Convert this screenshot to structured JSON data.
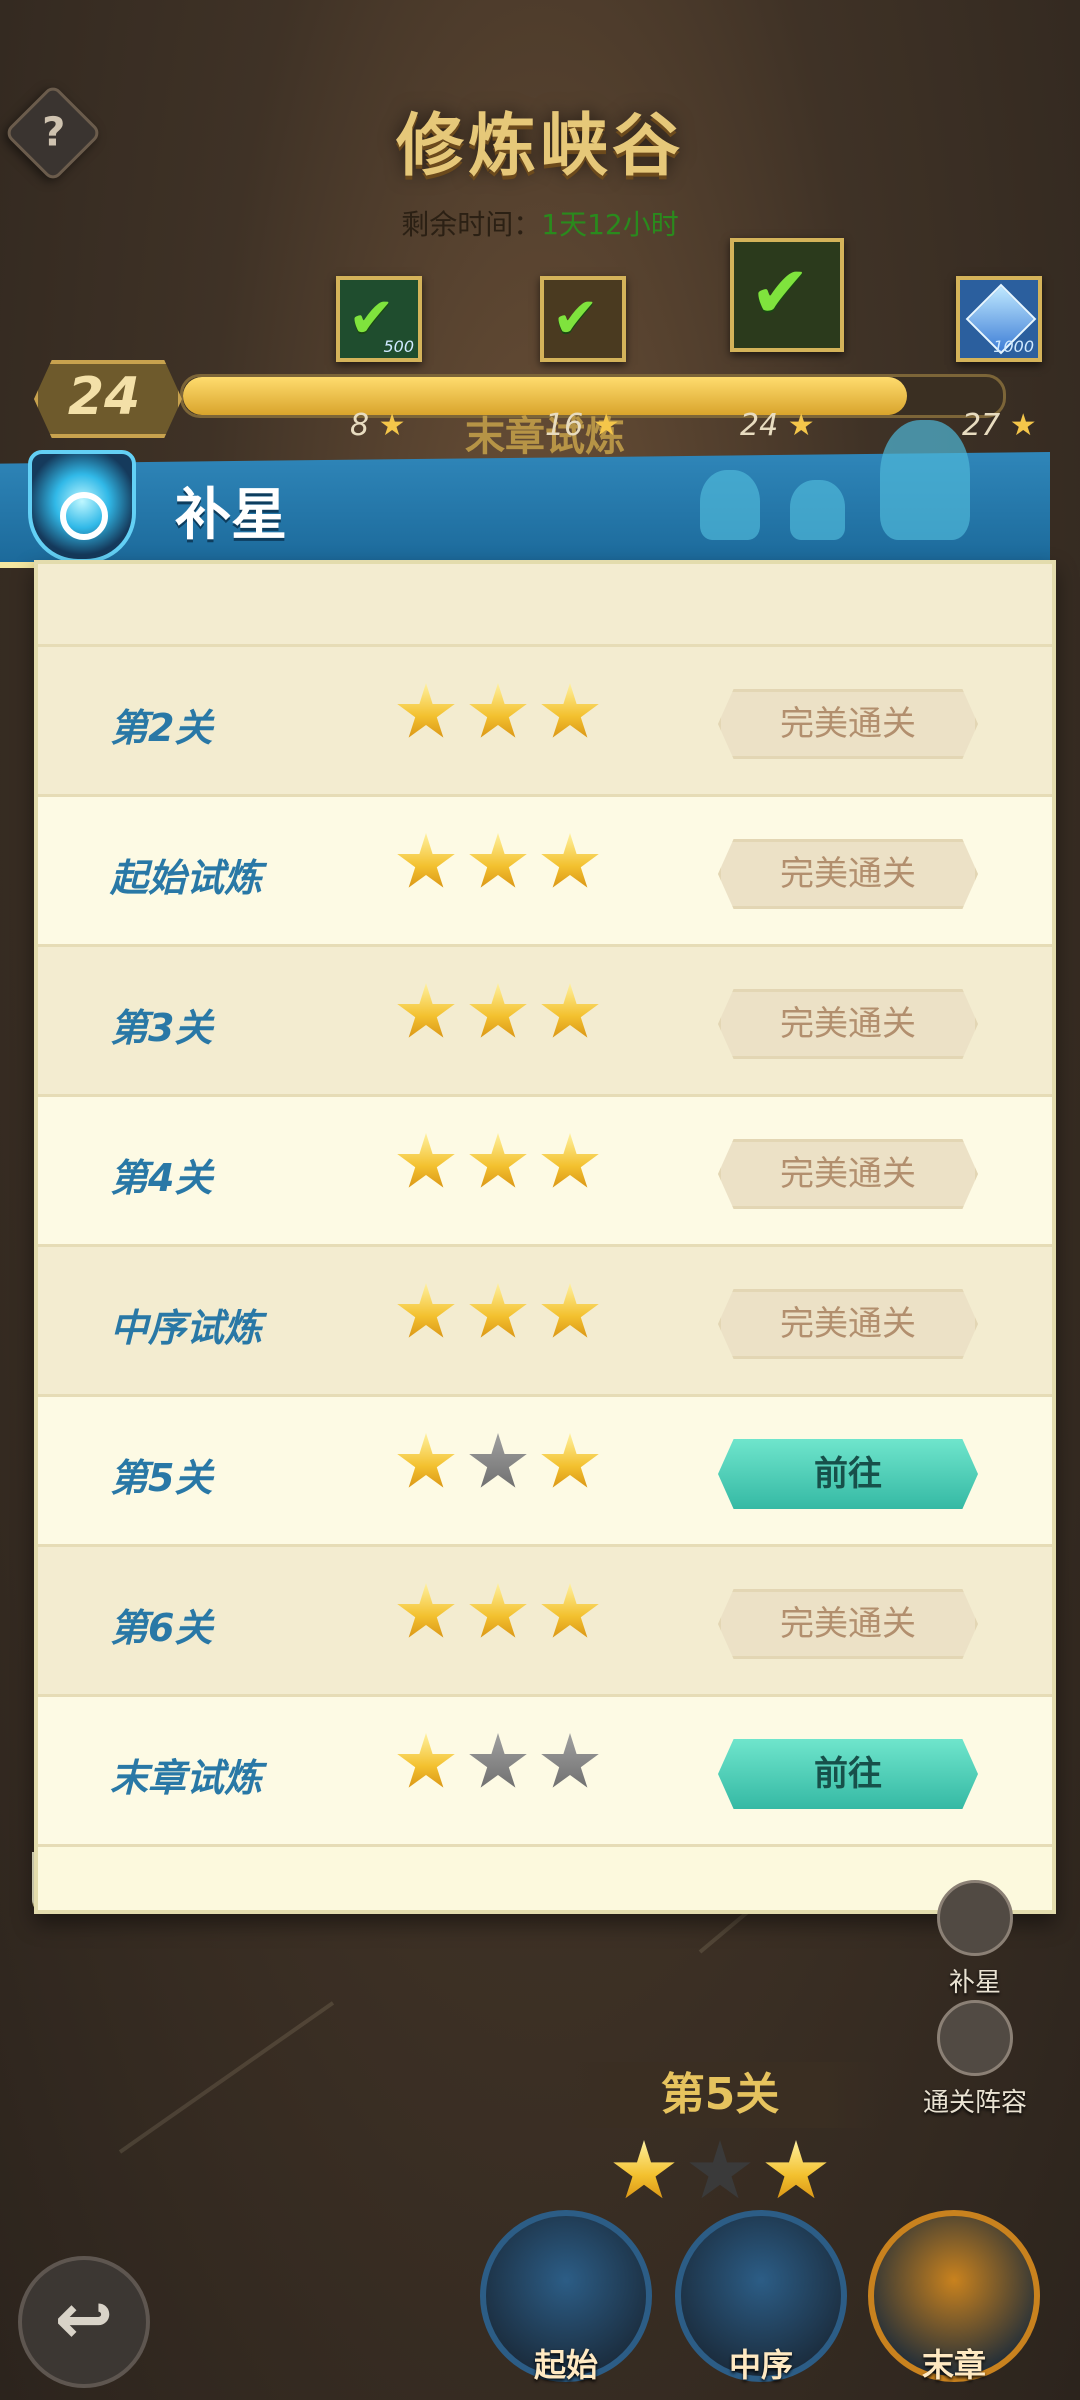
{
  "header": {
    "title": "修炼峡谷",
    "time_label": "剩余时间：",
    "time_value": "1天12小时",
    "help_icon": "?"
  },
  "rewards": [
    {
      "icon": "check-icon",
      "sub": "500"
    },
    {
      "icon": "check-icon",
      "sub": ""
    },
    {
      "icon": "check-icon",
      "sub": ""
    },
    {
      "icon": "diamond-icon",
      "sub": "1000"
    }
  ],
  "progress": {
    "level": "24",
    "fraction": 0.89,
    "milestones": [
      "8",
      "16",
      "24",
      "27"
    ],
    "chapter_banner": "末章试炼"
  },
  "panel": {
    "title": "补星",
    "rows": [
      {
        "label": "第2关",
        "stars": [
          1,
          1,
          1
        ],
        "button": "完美通关",
        "state": "done"
      },
      {
        "label": "起始试炼",
        "stars": [
          1,
          1,
          1
        ],
        "button": "完美通关",
        "state": "done"
      },
      {
        "label": "第3关",
        "stars": [
          1,
          1,
          1
        ],
        "button": "完美通关",
        "state": "done"
      },
      {
        "label": "第4关",
        "stars": [
          1,
          1,
          1
        ],
        "button": "完美通关",
        "state": "done"
      },
      {
        "label": "中序试炼",
        "stars": [
          1,
          1,
          1
        ],
        "button": "完美通关",
        "state": "done"
      },
      {
        "label": "第5关",
        "stars": [
          1,
          0,
          1
        ],
        "button": "前往",
        "state": "go"
      },
      {
        "label": "第6关",
        "stars": [
          1,
          1,
          1
        ],
        "button": "完美通关",
        "state": "done"
      },
      {
        "label": "末章试炼",
        "stars": [
          1,
          0,
          0
        ],
        "button": "前往",
        "state": "go"
      }
    ]
  },
  "side_buttons": {
    "supplement": "补星",
    "lineup": "通关阵容"
  },
  "stage": {
    "label": "第5关",
    "stars": [
      1,
      0,
      1
    ]
  },
  "chapters": [
    {
      "label": "起始",
      "color": "#2c5d86"
    },
    {
      "label": "中序",
      "color": "#2c5d86"
    },
    {
      "label": "末章",
      "color": "#c9821e"
    }
  ],
  "back_icon": "↩"
}
